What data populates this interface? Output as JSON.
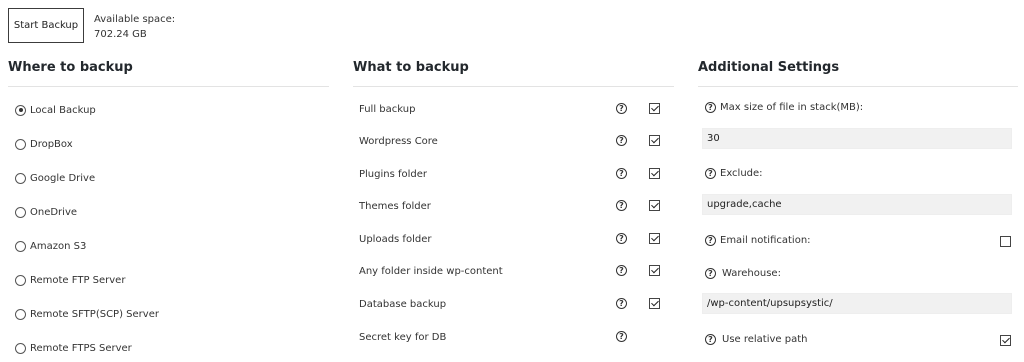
{
  "top": {
    "start_backup_label": "Start Backup",
    "available_space_label": "Available space:",
    "available_space_value": "702.24 GB"
  },
  "where": {
    "title": "Where to backup",
    "options": [
      {
        "label": "Local Backup",
        "checked": true
      },
      {
        "label": "DropBox",
        "checked": false
      },
      {
        "label": "Google Drive",
        "checked": false
      },
      {
        "label": "OneDrive",
        "checked": false
      },
      {
        "label": "Amazon S3",
        "checked": false
      },
      {
        "label": "Remote FTP Server",
        "checked": false
      },
      {
        "label": "Remote SFTP(SCP) Server",
        "checked": false
      },
      {
        "label": "Remote FTPS Server",
        "checked": false
      }
    ]
  },
  "what": {
    "title": "What to backup",
    "help_glyph": "?",
    "items": [
      {
        "label": "Full backup",
        "checked": true
      },
      {
        "label": "Wordpress Core",
        "checked": true
      },
      {
        "label": "Plugins folder",
        "checked": true
      },
      {
        "label": "Themes folder",
        "checked": true
      },
      {
        "label": "Uploads folder",
        "checked": true
      },
      {
        "label": "Any folder inside wp-content",
        "checked": true
      },
      {
        "label": "Database backup",
        "checked": true
      },
      {
        "label": "Secret key for DB",
        "checked": null
      }
    ]
  },
  "settings": {
    "title": "Additional Settings",
    "max_size_label": "Max size of file in stack(MB):",
    "max_size_value": "30",
    "exclude_label": "Exclude:",
    "exclude_value": "upgrade,cache",
    "email_label": "Email notification:",
    "email_checked": false,
    "warehouse_label": "Warehouse:",
    "warehouse_value": "/wp-content/upsupsystic/",
    "relative_label": "Use relative path",
    "relative_checked": true
  }
}
